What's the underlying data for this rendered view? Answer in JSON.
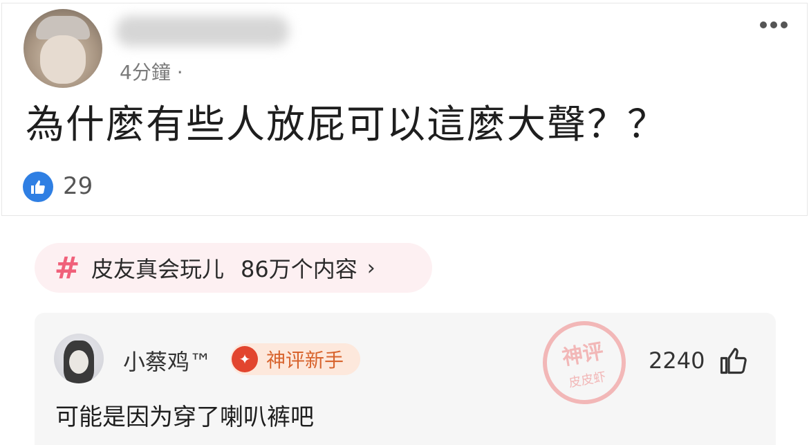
{
  "post": {
    "timestamp": "4分鐘 ·",
    "text": "為什麼有些人放屁可以這麼大聲？？",
    "like_count": "29"
  },
  "topic": {
    "name": "皮友真会玩儿",
    "count": "86万个内容",
    "chevron": "›"
  },
  "comment": {
    "username": "小蔡鸡™",
    "badge": "神评新手",
    "stamp_line1": "神评",
    "stamp_line2": "皮皮虾",
    "votes": "2240",
    "text": "可能是因为穿了喇叭裤吧"
  },
  "colors": {
    "like_blue": "#2f7fe3",
    "topic_pink": "#f0607a",
    "badge_orange": "#d8642e",
    "stamp_red": "#f1a3a3"
  }
}
